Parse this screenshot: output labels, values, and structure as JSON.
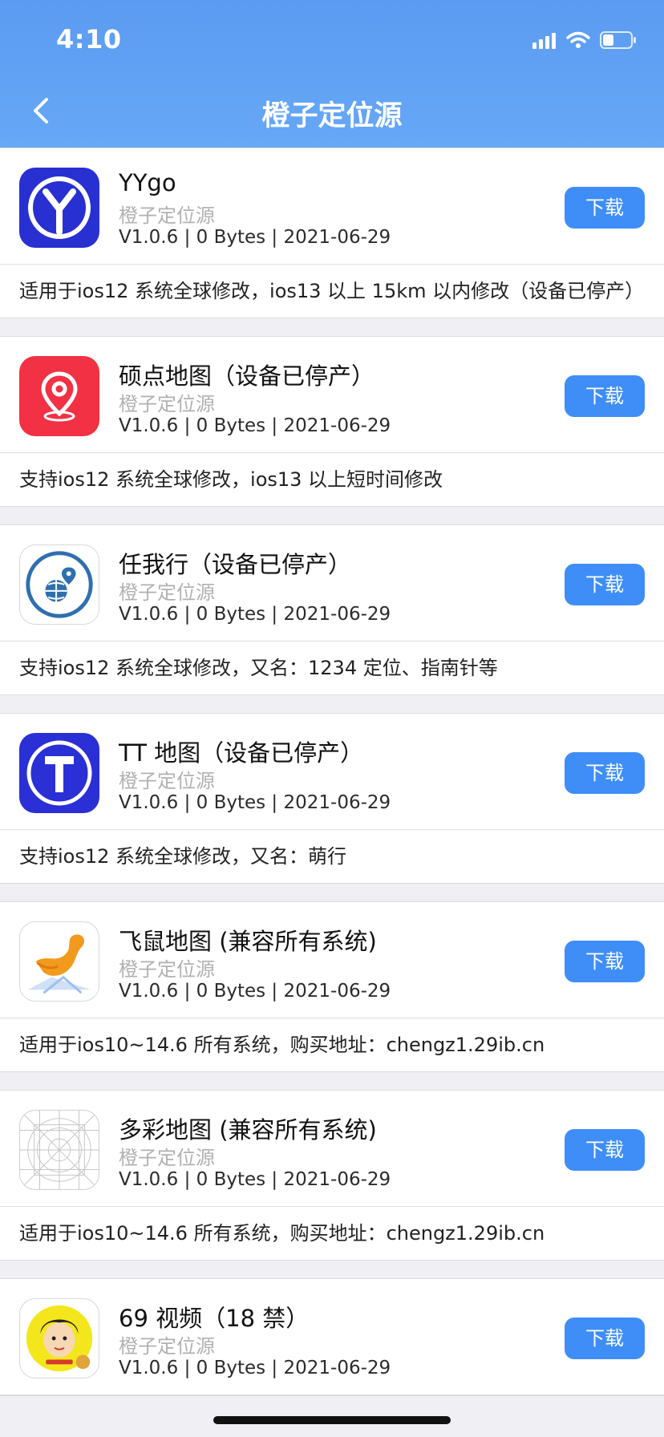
{
  "status_bar": {
    "time": "4:10"
  },
  "nav": {
    "title": "橙子定位源"
  },
  "apps": [
    {
      "name": "YYgo",
      "source": "橙子定位源",
      "meta": "V1.0.6 | 0 Bytes | 2021-06-29",
      "button": "下载",
      "desc": "适用于ios12 系统全球修改，ios13 以上 15km 以内修改（设备已停产）",
      "icon": "yygo-icon"
    },
    {
      "name": "硕点地图（设备已停产）",
      "source": "橙子定位源",
      "meta": "V1.0.6 | 0 Bytes | 2021-06-29",
      "button": "下载",
      "desc": "支持ios12 系统全球修改，ios13 以上短时间修改",
      "icon": "location-pin-icon"
    },
    {
      "name": "任我行（设备已停产）",
      "source": "橙子定位源",
      "meta": "V1.0.6 | 0 Bytes | 2021-06-29",
      "button": "下载",
      "desc": "支持ios12 系统全球修改，又名：1234 定位、指南针等",
      "icon": "globe-pin-icon"
    },
    {
      "name": "TT 地图（设备已停产）",
      "source": "橙子定位源",
      "meta": "V1.0.6 | 0 Bytes | 2021-06-29",
      "button": "下载",
      "desc": "支持ios12 系统全球修改，又名：萌行",
      "icon": "tt-icon"
    },
    {
      "name": "飞鼠地图 (兼容所有系统)",
      "source": "橙子定位源",
      "meta": "V1.0.6 | 0 Bytes | 2021-06-29",
      "button": "下载",
      "desc": "适用于ios10~14.6 所有系统，购买地址：chengz1.29ib.cn",
      "icon": "flying-squirrel-icon"
    },
    {
      "name": "多彩地图 (兼容所有系统)",
      "source": "橙子定位源",
      "meta": "V1.0.6 | 0 Bytes | 2021-06-29",
      "button": "下载",
      "desc": "适用于ios10~14.6 所有系统，购买地址：chengz1.29ib.cn",
      "icon": "placeholder-grid-icon"
    },
    {
      "name": "69 视频（18 禁）",
      "source": "橙子定位源",
      "meta": "V1.0.6 | 0 Bytes | 2021-06-29",
      "button": "下载",
      "desc": "",
      "icon": "cartoon-face-icon"
    }
  ],
  "colors": {
    "header": "#5b9bf2",
    "button": "#3f8ef7",
    "page_bg": "#efeff4"
  }
}
